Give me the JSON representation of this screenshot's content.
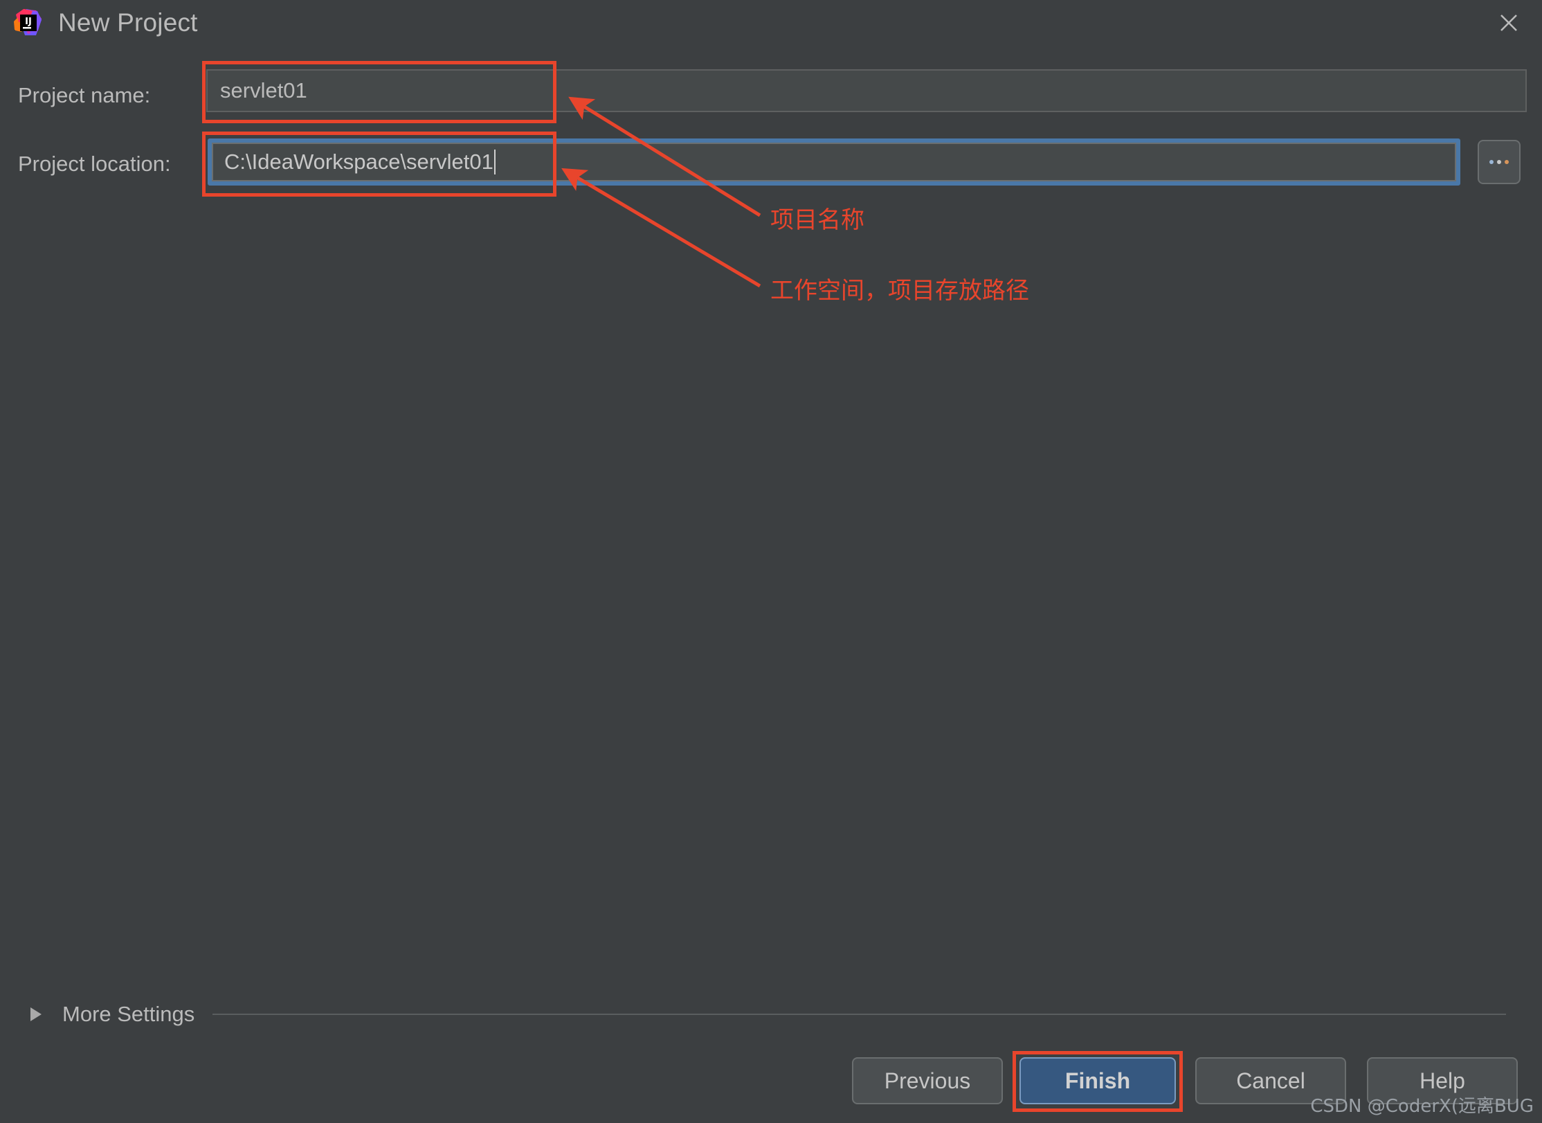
{
  "window": {
    "title": "New Project",
    "logo_icon": "intellij-idea-logo",
    "logo_text": "IJ",
    "close_icon": "close-icon"
  },
  "form": {
    "project_name": {
      "label": "Project name:",
      "value": "servlet01"
    },
    "project_location": {
      "label": "Project location:",
      "value": "C:\\IdeaWorkspace\\servlet01"
    },
    "browse_button": {
      "label": "...",
      "icon": "ellipsis-icon"
    }
  },
  "annotations": {
    "color": "#E8452C",
    "items": [
      {
        "text": "项目名称",
        "target": "project-name-field"
      },
      {
        "text": "工作空间，项目存放路径",
        "target": "project-location-field"
      }
    ]
  },
  "more_settings": {
    "label": "More Settings",
    "expand_icon": "triangle-right-icon",
    "expanded": false
  },
  "buttons": {
    "previous": "Previous",
    "finish": "Finish",
    "cancel": "Cancel",
    "help": "Help",
    "default_button": "Finish",
    "default_color": "#365880"
  },
  "watermark": {
    "text": "CSDN @CoderX(远离BUG"
  },
  "theme": {
    "dialog_background": "#3C3F41",
    "field_background": "#45494A",
    "text_color": "#BBBBBB",
    "focus_ring": "#4A78A8",
    "accent_red": "#E8452C"
  }
}
